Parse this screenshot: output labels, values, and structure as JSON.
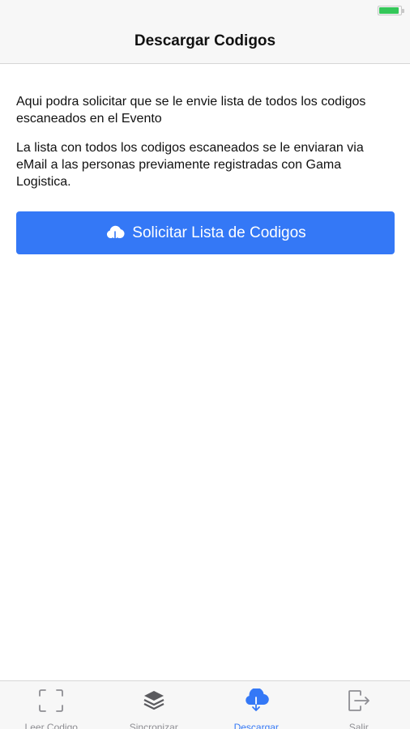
{
  "nav": {
    "title": "Descargar Codigos"
  },
  "content": {
    "paragraph_1": "Aqui podra solicitar que se le envie lista de todos los codigos escaneados en el Evento",
    "paragraph_2": "La lista con todos los codigos escaneados se le enviaran via eMail a las personas previamente registradas con Gama Logistica."
  },
  "button": {
    "label": "Solicitar Lista de Codigos",
    "icon": "cloud-download-icon"
  },
  "tabs": [
    {
      "label": "Leer Codigo",
      "icon": "scan-frame-icon",
      "active": false
    },
    {
      "label": "Sincronizar",
      "icon": "layers-icon",
      "active": false
    },
    {
      "label": "Descargar",
      "icon": "cloud-download-icon",
      "active": true
    },
    {
      "label": "Salir",
      "icon": "logout-icon",
      "active": false
    }
  ],
  "colors": {
    "accent": "#3478f6",
    "inactive": "#8e8e93",
    "battery": "#34c759",
    "bar_bg": "#f7f7f7"
  }
}
